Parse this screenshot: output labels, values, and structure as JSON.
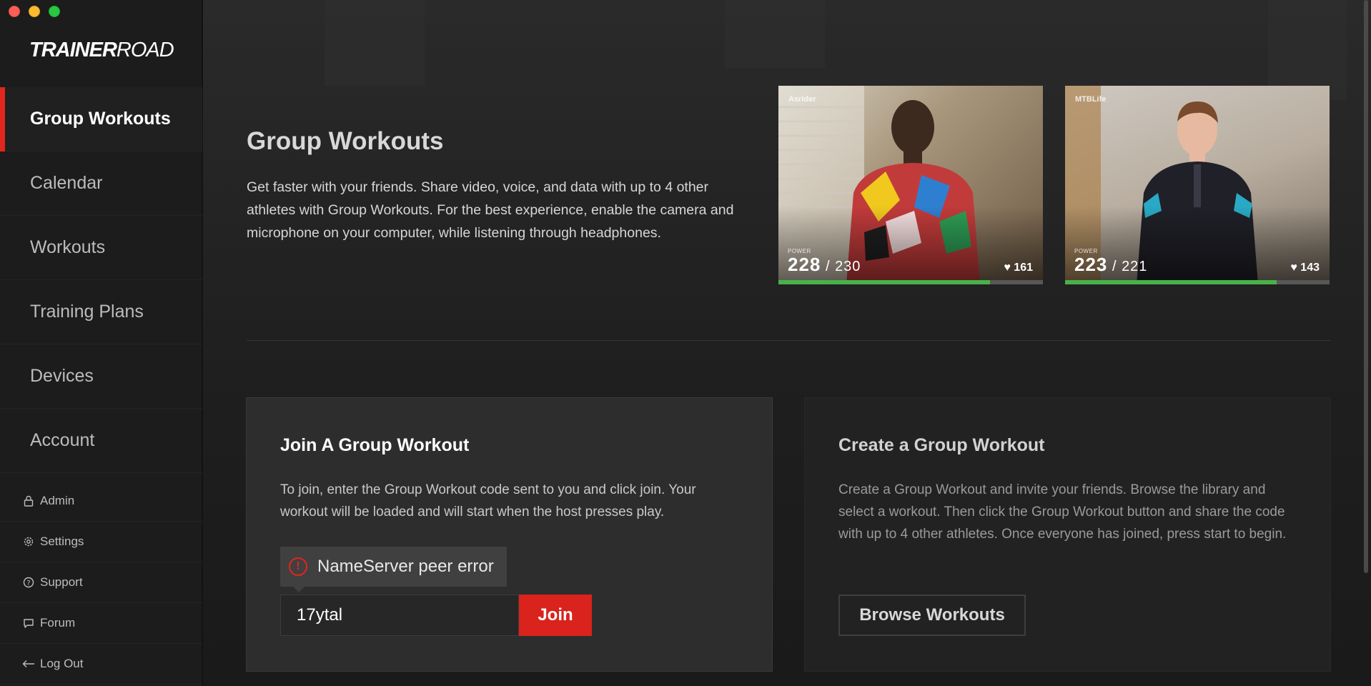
{
  "window": {
    "title": "TrainerRoad"
  },
  "sidebar": {
    "logo_bold": "TRAINER",
    "logo_light": "ROAD",
    "nav": [
      {
        "label": "Group Workouts",
        "active": true
      },
      {
        "label": "Calendar"
      },
      {
        "label": "Workouts"
      },
      {
        "label": "Training Plans"
      },
      {
        "label": "Devices"
      },
      {
        "label": "Account"
      }
    ],
    "sub": [
      {
        "label": "Admin",
        "icon": "lock-icon"
      },
      {
        "label": "Settings",
        "icon": "gear-icon"
      },
      {
        "label": "Support",
        "icon": "question-icon"
      },
      {
        "label": "Forum",
        "icon": "chat-icon"
      },
      {
        "label": "Log Out",
        "icon": "arrow-left-icon"
      }
    ]
  },
  "hero": {
    "title": "Group Workouts",
    "description": "Get faster with your friends. Share video, voice, and data with up to 4 other athletes with Group Workouts. For the best experience, enable the camera and microphone on your computer, while listening through headphones."
  },
  "tiles": [
    {
      "username": "Asrider",
      "power_label": "POWER",
      "power": "228",
      "target": "230",
      "heart_rate": "161",
      "progress": 0.8
    },
    {
      "username": "MTBLife",
      "power_label": "POWER",
      "power": "223",
      "target": "221",
      "heart_rate": "143",
      "progress": 0.8
    }
  ],
  "join": {
    "title": "Join A Group Workout",
    "description": "To join, enter the Group Workout code sent to you and click join. Your workout will be loaded and will start when the host presses play.",
    "error": "NameServer peer error",
    "code_value": "17ytal",
    "button": "Join"
  },
  "create": {
    "title": "Create a Group Workout",
    "description": "Create a Group Workout and invite your friends. Browse the library and select a workout. Then click the Group Workout button and share the code with up to 4 other athletes. Once everyone has joined, press start to begin.",
    "button": "Browse Workouts"
  },
  "colors": {
    "accent": "#e0261f",
    "progress": "#48b24a"
  }
}
